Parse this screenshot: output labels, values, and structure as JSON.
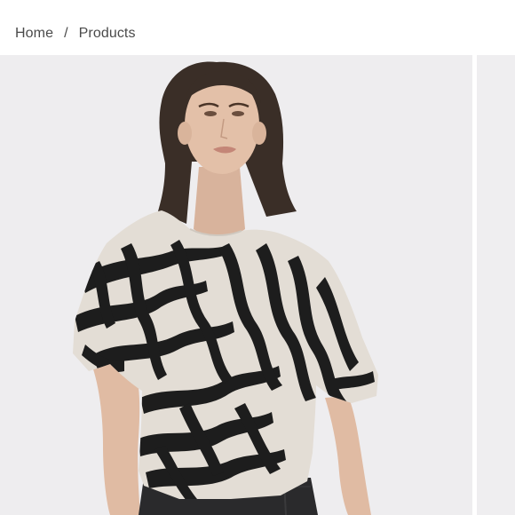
{
  "breadcrumb": {
    "home_label": "Home",
    "separator": "/",
    "current_label": "Products"
  },
  "gallery": {
    "main_image": "model-wearing-zebra-print-top",
    "next_image": "next-product-image-peek"
  },
  "colors": {
    "text": "#4a4a4a",
    "gallery_bg": "#eeedef",
    "print_light": "#e3ddd5",
    "print_dark": "#1d1d1d"
  }
}
